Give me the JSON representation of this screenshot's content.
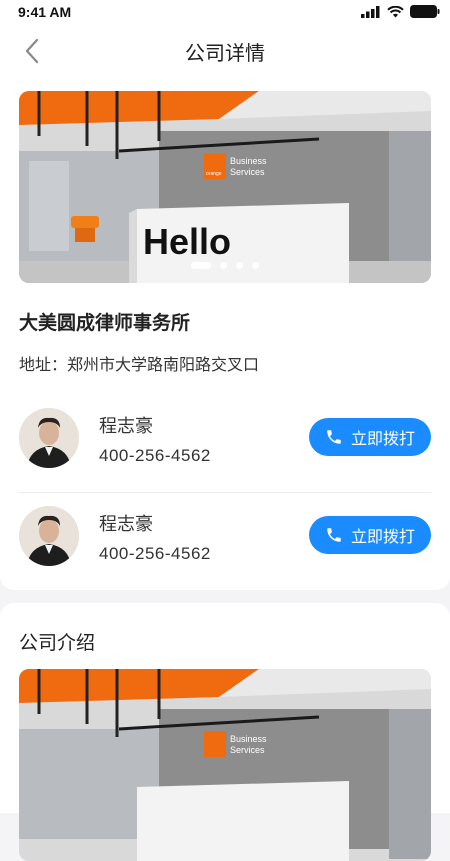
{
  "status_bar": {
    "time": "9:41 AM"
  },
  "nav": {
    "title": "公司详情"
  },
  "banner": {
    "dots": 4,
    "active_dot": 0,
    "sign_text": "Hello",
    "logo_text": "orange",
    "brand_line1": "Business",
    "brand_line2": "Services"
  },
  "company": {
    "name": "大美圆成律师事务所",
    "address": "地址：郑州市大学路南阳路交叉口"
  },
  "contacts": [
    {
      "name": "程志豪",
      "phone": "400-256-4562",
      "call_label": "立即拨打"
    },
    {
      "name": "程志豪",
      "phone": "400-256-4562",
      "call_label": "立即拨打"
    }
  ],
  "intro": {
    "title": "公司介绍"
  },
  "colors": {
    "accent": "#1a8cff",
    "orange": "#f06a0f"
  },
  "icons": [
    "back-chevron-icon",
    "phone-icon",
    "signal-icon",
    "wifi-icon",
    "battery-icon"
  ]
}
